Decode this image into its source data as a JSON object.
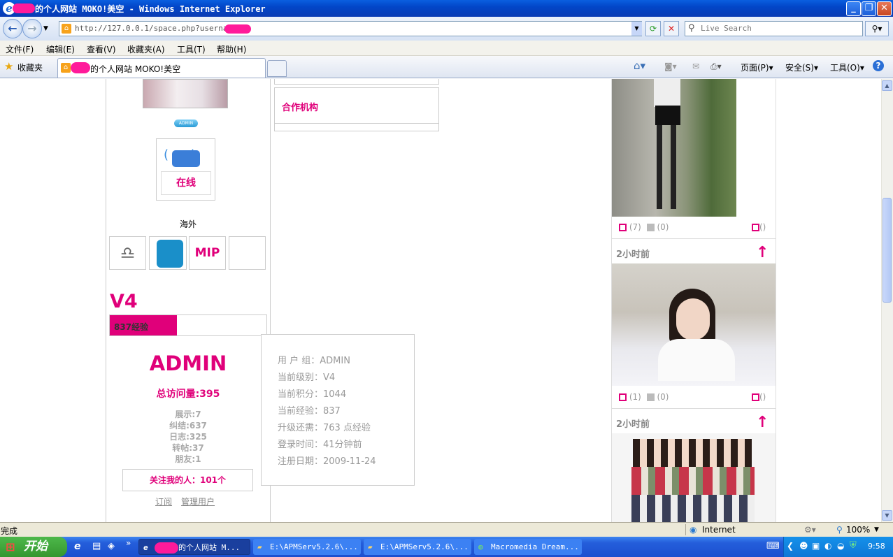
{
  "window": {
    "title": "的个人网站 MOKO!美空 - Windows Internet Explorer"
  },
  "addressbar": {
    "url": "http://127.0.0.1/space.php?username=",
    "search_placeholder": "Live Search"
  },
  "menu": [
    "文件(F)",
    "编辑(E)",
    "查看(V)",
    "收藏夹(A)",
    "工具(T)",
    "帮助(H)"
  ],
  "favorites": {
    "label": "收藏夹",
    "tab_title": "的个人网站 MOKO!美空"
  },
  "commandbar": {
    "page": "页面(P)",
    "safety": "安全(S)",
    "tools": "工具(O)"
  },
  "left": {
    "admin_badge": "ADMIN",
    "online": "在线",
    "region": "海外",
    "mip": "MIP",
    "level": "V4",
    "exp_label": "837经验",
    "exp_progress": 0.43,
    "username": "ADMIN",
    "visits": "总访问量:395",
    "stats": [
      "展示:7",
      "纠结:637",
      "日志:325",
      "转帖:37",
      "朋友:1"
    ],
    "followers": "关注我的人：101个",
    "subscribe": "订阅",
    "manage": "管理用户"
  },
  "middle": {
    "partner": "合作机构"
  },
  "tooltip": [
    "用 户 组：ADMIN",
    "当前级别：V4",
    "当前积分：1044",
    "当前经验：837",
    "升级还需：763 点经验",
    "登录时间：41分钟前",
    "注册日期：2009-11-24"
  ],
  "right": {
    "posts": [
      {
        "comments": "(7)",
        "likes": "(0)",
        "msg": "()"
      },
      {
        "time": "2小时前",
        "comments": "(1)",
        "likes": "(0)",
        "msg": "()"
      },
      {
        "time": "2小时前"
      }
    ]
  },
  "status": {
    "text": "完成",
    "zone": "Internet",
    "zoom": "100%"
  },
  "taskbar": {
    "start": "开始",
    "tasks": [
      "的个人网站 M...",
      "E:\\APMServ5.2.6\\...",
      "E:\\APMServ5.2.6\\...",
      "Macromedia Dream..."
    ],
    "clock": "9:58"
  },
  "colors": {
    "accent": "#e0007a",
    "titlebar": "#0a5fe0",
    "taskbar": "#245edb"
  }
}
